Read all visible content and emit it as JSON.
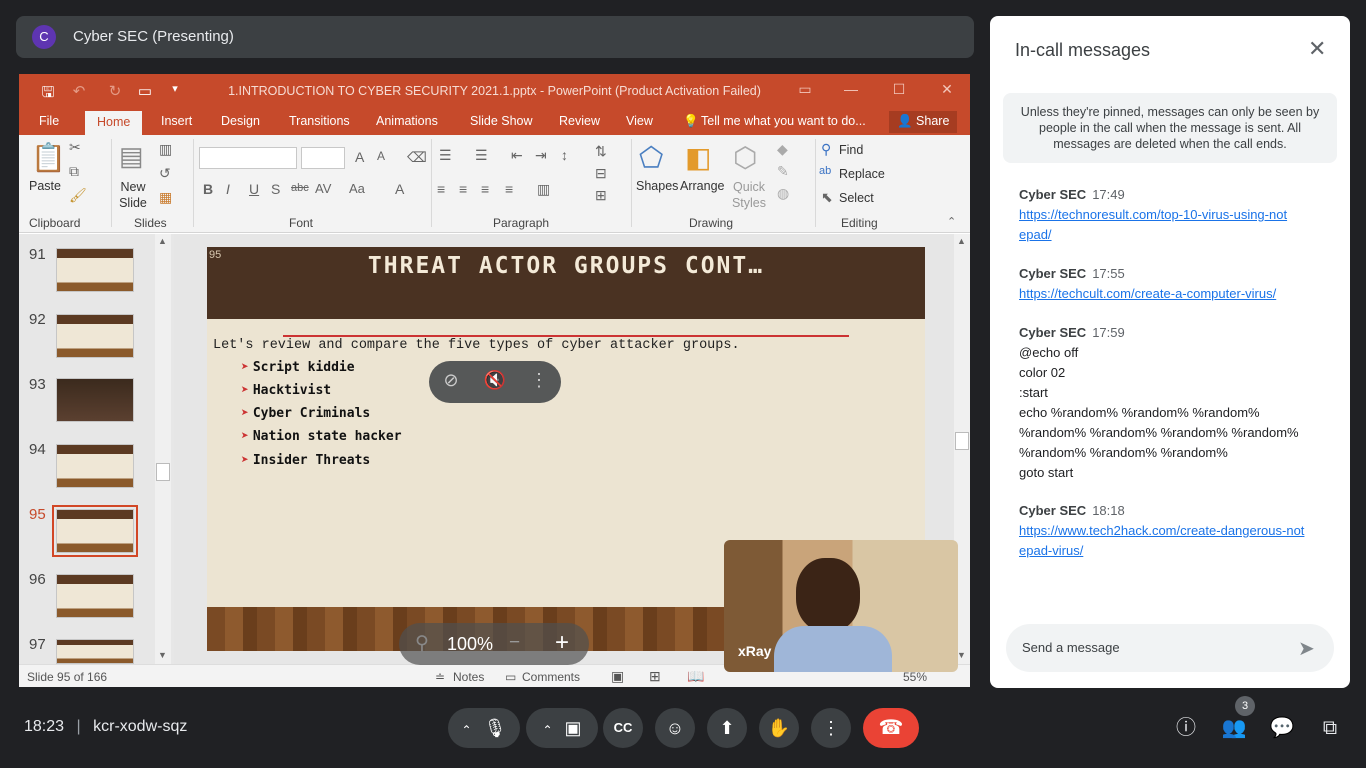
{
  "presenter": {
    "avatar": "C",
    "title": "Cyber SEC (Presenting)"
  },
  "ppt": {
    "window_title": "1.INTRODUCTION TO CYBER SECURITY 2021.1.pptx - PowerPoint (Product Activation Failed)",
    "tabs": [
      "File",
      "Home",
      "Insert",
      "Design",
      "Transitions",
      "Animations",
      "Slide Show",
      "Review",
      "View"
    ],
    "tell_me": "Tell me what you want to do...",
    "share": "Share",
    "ribbon": {
      "paste": "Paste",
      "new_slide": "New Slide",
      "shapes": "Shapes",
      "arrange": "Arrange",
      "quick_styles": "Quick Styles",
      "find": "Find",
      "replace": "Replace",
      "select": "Select",
      "groups": {
        "clipboard": "Clipboard",
        "slides": "Slides",
        "font": "Font",
        "paragraph": "Paragraph",
        "drawing": "Drawing",
        "editing": "Editing"
      }
    },
    "thumbnails": [
      "91",
      "92",
      "93",
      "94",
      "95",
      "96",
      "97"
    ],
    "selected_thumb": "95",
    "slide": {
      "number": "95",
      "title": "THREAT ACTOR GROUPS CONT…",
      "intro": "Let's review and compare the five types of cyber attacker groups.",
      "bullets": [
        "Script kiddie",
        "Hacktivist",
        "Cyber Criminals",
        "Nation state hacker",
        "Insider Threats"
      ]
    },
    "status": {
      "slide_of": "Slide 95 of 166",
      "notes": "Notes",
      "comments": "Comments",
      "zoom": "55%"
    }
  },
  "zoom_overlay": "100%",
  "self_view": {
    "name": "xRay"
  },
  "chat": {
    "header": "In-call messages",
    "notice": "Unless they're pinned, messages can only be seen by people in the call when the message is sent. All messages are deleted when the call ends.",
    "messages": [
      {
        "sender": "Cyber SEC",
        "time": "17:49",
        "link": "https://technoresult.com/top-10-virus-using-notepad/"
      },
      {
        "sender": "Cyber SEC",
        "time": "17:55",
        "link": "https://techcult.com/create-a-computer-virus/"
      },
      {
        "sender": "Cyber SEC",
        "time": "17:59",
        "lines": [
          "@echo off",
          "color 02",
          ":start",
          "echo %random% %random% %random% %random% %random% %random% %random% %random% %random% %random%",
          "goto start"
        ]
      },
      {
        "sender": "Cyber SEC",
        "time": "18:18",
        "link": "https://www.tech2hack.com/create-dangerous-notepad-virus/"
      }
    ],
    "input_placeholder": "Send a message"
  },
  "meeting": {
    "time": "18:23",
    "code": "kcr-xodw-sqz",
    "participants": "3"
  }
}
